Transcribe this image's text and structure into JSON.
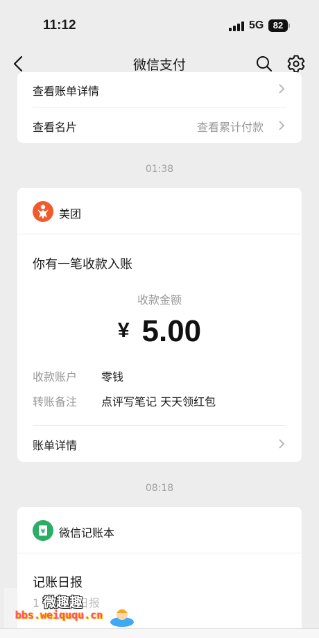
{
  "status_bar": {
    "time": "11:12",
    "network": "5G",
    "battery": "82"
  },
  "nav": {
    "title": "微信支付",
    "icons": [
      "back-icon",
      "search-icon",
      "gear-icon"
    ]
  },
  "top_card": {
    "row1_label": "查看账单详情",
    "row2_label": "查看名片",
    "row2_value": "查看累计付款"
  },
  "messages": [
    {
      "time": "01:38",
      "sender": "美团",
      "heading": "你有一笔收款入账",
      "amount_label": "收款金额",
      "currency": "¥",
      "amount": "5.00",
      "fields": [
        {
          "label": "收款账户",
          "value": "零钱"
        },
        {
          "label": "转账备注",
          "value": "点评写笔记 天天领红包"
        }
      ],
      "detail_link": "账单详情"
    },
    {
      "time": "08:18",
      "sender": "微信记账本",
      "heading": "记账日报",
      "subtext": "1 (周日) 日报"
    }
  ],
  "watermark": {
    "name": "微趣趣",
    "url": "bbs.weiququ.cn"
  },
  "colors": {
    "background": "#ededed",
    "card": "#ffffff",
    "meituan": "#f25a2c",
    "ledger": "#2aae67",
    "muted": "#999999"
  }
}
